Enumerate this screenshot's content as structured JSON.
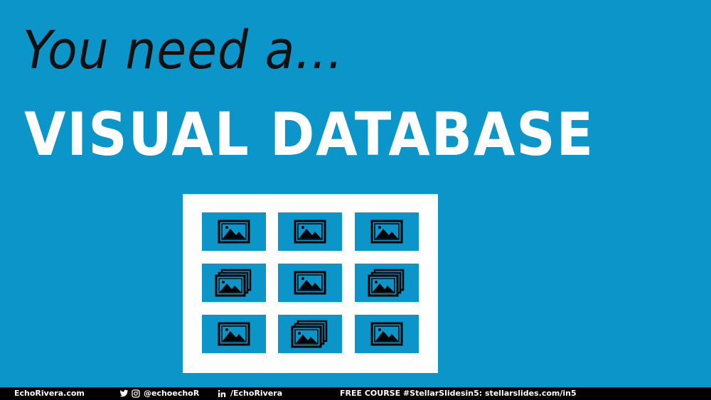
{
  "slide": {
    "subtitle": "You need a...",
    "title": "VISUAL DATABASE"
  },
  "grid": {
    "tiles": [
      {
        "icon": "image-icon"
      },
      {
        "icon": "image-icon"
      },
      {
        "icon": "image-icon"
      },
      {
        "icon": "image-stack-icon"
      },
      {
        "icon": "image-icon"
      },
      {
        "icon": "image-stack-icon"
      },
      {
        "icon": "image-icon"
      },
      {
        "icon": "image-stack-icon"
      },
      {
        "icon": "image-icon"
      }
    ]
  },
  "footer": {
    "website": "EchoRivera.com",
    "social_handle": "@echoechoR",
    "linkedin": "/EchoRivera",
    "course": "FREE COURSE #StellarSlidesin5: stellarslides.com/in5"
  },
  "colors": {
    "background": "#0b95c9",
    "title": "#ffffff",
    "subtitle": "#111111",
    "footer": "#000000"
  }
}
